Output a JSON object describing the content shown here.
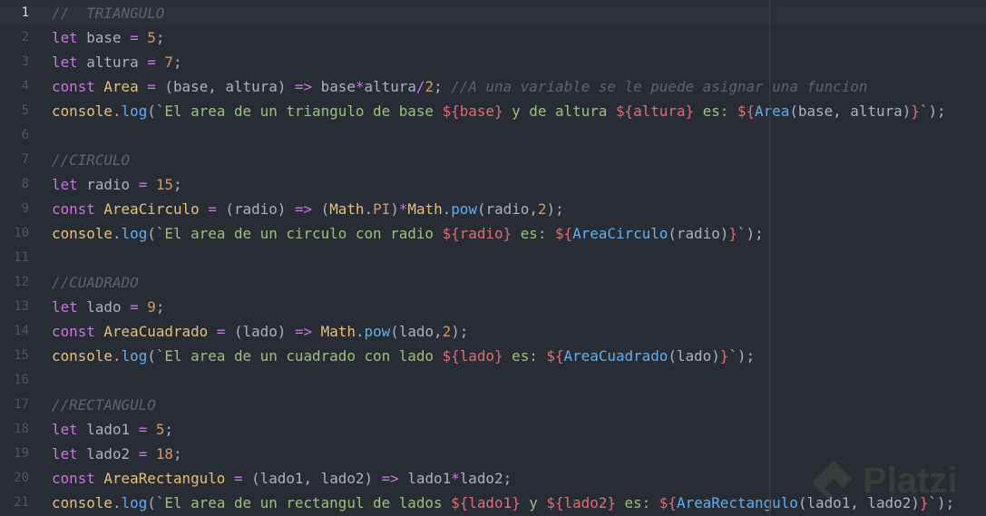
{
  "editor": {
    "active_line": 1,
    "lines": [
      {
        "n": "1",
        "tokens": [
          [
            "t-comment",
            "//  TRIANGULO"
          ]
        ]
      },
      {
        "n": "2",
        "tokens": [
          [
            "t-kw",
            "let"
          ],
          [
            "t-plain",
            " base "
          ],
          [
            "t-op",
            "="
          ],
          [
            "t-plain",
            " "
          ],
          [
            "t-num",
            "5"
          ],
          [
            "t-plain",
            ";"
          ]
        ]
      },
      {
        "n": "3",
        "tokens": [
          [
            "t-kw",
            "let"
          ],
          [
            "t-plain",
            " altura "
          ],
          [
            "t-op",
            "="
          ],
          [
            "t-plain",
            " "
          ],
          [
            "t-num",
            "7"
          ],
          [
            "t-plain",
            ";"
          ]
        ]
      },
      {
        "n": "4",
        "tokens": [
          [
            "t-kw",
            "const"
          ],
          [
            "t-plain",
            " "
          ],
          [
            "t-cls",
            "Area"
          ],
          [
            "t-plain",
            " "
          ],
          [
            "t-op",
            "="
          ],
          [
            "t-plain",
            " (base, altura) "
          ],
          [
            "t-op",
            "=>"
          ],
          [
            "t-plain",
            " base"
          ],
          [
            "t-op",
            "*"
          ],
          [
            "t-plain",
            "altura"
          ],
          [
            "t-op",
            "/"
          ],
          [
            "t-num",
            "2"
          ],
          [
            "t-plain",
            "; "
          ],
          [
            "t-comment",
            "//A una variable se le puede asignar una funcion"
          ]
        ]
      },
      {
        "n": "5",
        "tokens": [
          [
            "t-cls",
            "console"
          ],
          [
            "t-plain",
            "."
          ],
          [
            "t-fn",
            "log"
          ],
          [
            "t-plain",
            "("
          ],
          [
            "t-str",
            "`El area de un triangulo de base "
          ],
          [
            "t-tpl",
            "${"
          ],
          [
            "t-var",
            "base"
          ],
          [
            "t-tpl",
            "}"
          ],
          [
            "t-str",
            " y de altura "
          ],
          [
            "t-tpl",
            "${"
          ],
          [
            "t-var",
            "altura"
          ],
          [
            "t-tpl",
            "}"
          ],
          [
            "t-str",
            " es: "
          ],
          [
            "t-tpl",
            "${"
          ],
          [
            "t-fn",
            "Area"
          ],
          [
            "t-plain",
            "(base, altura)"
          ],
          [
            "t-tpl",
            "}"
          ],
          [
            "t-str",
            "`"
          ],
          [
            "t-plain",
            ");"
          ]
        ]
      },
      {
        "n": "6",
        "tokens": []
      },
      {
        "n": "7",
        "tokens": [
          [
            "t-comment",
            "//CIRCULO"
          ]
        ]
      },
      {
        "n": "8",
        "tokens": [
          [
            "t-kw",
            "let"
          ],
          [
            "t-plain",
            " radio "
          ],
          [
            "t-op",
            "="
          ],
          [
            "t-plain",
            " "
          ],
          [
            "t-num",
            "15"
          ],
          [
            "t-plain",
            ";"
          ]
        ]
      },
      {
        "n": "9",
        "tokens": [
          [
            "t-kw",
            "const"
          ],
          [
            "t-plain",
            " "
          ],
          [
            "t-cls",
            "AreaCirculo"
          ],
          [
            "t-plain",
            " "
          ],
          [
            "t-op",
            "="
          ],
          [
            "t-plain",
            " (radio) "
          ],
          [
            "t-op",
            "=>"
          ],
          [
            "t-plain",
            " ("
          ],
          [
            "t-cls",
            "Math"
          ],
          [
            "t-plain",
            "."
          ],
          [
            "t-prop",
            "PI"
          ],
          [
            "t-plain",
            ")"
          ],
          [
            "t-op",
            "*"
          ],
          [
            "t-cls",
            "Math"
          ],
          [
            "t-plain",
            "."
          ],
          [
            "t-fn",
            "pow"
          ],
          [
            "t-plain",
            "(radio,"
          ],
          [
            "t-num",
            "2"
          ],
          [
            "t-plain",
            ");"
          ]
        ]
      },
      {
        "n": "10",
        "tokens": [
          [
            "t-cls",
            "console"
          ],
          [
            "t-plain",
            "."
          ],
          [
            "t-fn",
            "log"
          ],
          [
            "t-plain",
            "("
          ],
          [
            "t-str",
            "`El area de un circulo con radio "
          ],
          [
            "t-tpl",
            "${"
          ],
          [
            "t-var",
            "radio"
          ],
          [
            "t-tpl",
            "}"
          ],
          [
            "t-str",
            " es: "
          ],
          [
            "t-tpl",
            "${"
          ],
          [
            "t-fn",
            "AreaCirculo"
          ],
          [
            "t-plain",
            "(radio)"
          ],
          [
            "t-tpl",
            "}"
          ],
          [
            "t-str",
            "`"
          ],
          [
            "t-plain",
            ");"
          ]
        ]
      },
      {
        "n": "11",
        "tokens": []
      },
      {
        "n": "12",
        "tokens": [
          [
            "t-comment",
            "//CUADRADO"
          ]
        ]
      },
      {
        "n": "13",
        "tokens": [
          [
            "t-kw",
            "let"
          ],
          [
            "t-plain",
            " lado "
          ],
          [
            "t-op",
            "="
          ],
          [
            "t-plain",
            " "
          ],
          [
            "t-num",
            "9"
          ],
          [
            "t-plain",
            ";"
          ]
        ]
      },
      {
        "n": "14",
        "tokens": [
          [
            "t-kw",
            "const"
          ],
          [
            "t-plain",
            " "
          ],
          [
            "t-cls",
            "AreaCuadrado"
          ],
          [
            "t-plain",
            " "
          ],
          [
            "t-op",
            "="
          ],
          [
            "t-plain",
            " (lado) "
          ],
          [
            "t-op",
            "=>"
          ],
          [
            "t-plain",
            " "
          ],
          [
            "t-cls",
            "Math"
          ],
          [
            "t-plain",
            "."
          ],
          [
            "t-fn",
            "pow"
          ],
          [
            "t-plain",
            "(lado,"
          ],
          [
            "t-num",
            "2"
          ],
          [
            "t-plain",
            ");"
          ]
        ]
      },
      {
        "n": "15",
        "tokens": [
          [
            "t-cls",
            "console"
          ],
          [
            "t-plain",
            "."
          ],
          [
            "t-fn",
            "log"
          ],
          [
            "t-plain",
            "("
          ],
          [
            "t-str",
            "`El area de un cuadrado con lado "
          ],
          [
            "t-tpl",
            "${"
          ],
          [
            "t-var",
            "lado"
          ],
          [
            "t-tpl",
            "}"
          ],
          [
            "t-str",
            " es: "
          ],
          [
            "t-tpl",
            "${"
          ],
          [
            "t-fn",
            "AreaCuadrado"
          ],
          [
            "t-plain",
            "(lado)"
          ],
          [
            "t-tpl",
            "}"
          ],
          [
            "t-str",
            "`"
          ],
          [
            "t-plain",
            ");"
          ]
        ]
      },
      {
        "n": "16",
        "tokens": []
      },
      {
        "n": "17",
        "tokens": [
          [
            "t-comment",
            "//RECTANGULO"
          ]
        ]
      },
      {
        "n": "18",
        "tokens": [
          [
            "t-kw",
            "let"
          ],
          [
            "t-plain",
            " lado1 "
          ],
          [
            "t-op",
            "="
          ],
          [
            "t-plain",
            " "
          ],
          [
            "t-num",
            "5"
          ],
          [
            "t-plain",
            ";"
          ]
        ]
      },
      {
        "n": "19",
        "tokens": [
          [
            "t-kw",
            "let"
          ],
          [
            "t-plain",
            " lado2 "
          ],
          [
            "t-op",
            "="
          ],
          [
            "t-plain",
            " "
          ],
          [
            "t-num",
            "18"
          ],
          [
            "t-plain",
            ";"
          ]
        ]
      },
      {
        "n": "20",
        "tokens": [
          [
            "t-kw",
            "const"
          ],
          [
            "t-plain",
            " "
          ],
          [
            "t-cls",
            "AreaRectangulo"
          ],
          [
            "t-plain",
            " "
          ],
          [
            "t-op",
            "="
          ],
          [
            "t-plain",
            " (lado1, lado2) "
          ],
          [
            "t-op",
            "=>"
          ],
          [
            "t-plain",
            " lado1"
          ],
          [
            "t-op",
            "*"
          ],
          [
            "t-plain",
            "lado2;"
          ]
        ]
      },
      {
        "n": "21",
        "tokens": [
          [
            "t-cls",
            "console"
          ],
          [
            "t-plain",
            "."
          ],
          [
            "t-fn",
            "log"
          ],
          [
            "t-plain",
            "("
          ],
          [
            "t-str",
            "`El area de un rectangul de lados "
          ],
          [
            "t-tpl",
            "${"
          ],
          [
            "t-var",
            "lado1"
          ],
          [
            "t-tpl",
            "}"
          ],
          [
            "t-str",
            " y "
          ],
          [
            "t-tpl",
            "${"
          ],
          [
            "t-var",
            "lado2"
          ],
          [
            "t-tpl",
            "}"
          ],
          [
            "t-str",
            " es: "
          ],
          [
            "t-tpl",
            "${"
          ],
          [
            "t-fn",
            "AreaRectangulo"
          ],
          [
            "t-plain",
            "(lado1, lado2)"
          ],
          [
            "t-tpl",
            "}"
          ],
          [
            "t-str",
            "`"
          ],
          [
            "t-plain",
            ");"
          ]
        ]
      }
    ]
  },
  "watermark": {
    "icon": "platzi-logo-icon",
    "text": "Platzi"
  },
  "colors": {
    "background": "#282c34",
    "keyword": "#c678dd",
    "number": "#d19a66",
    "string": "#98c379",
    "function": "#61afef",
    "class": "#e5c07b",
    "comment": "#5c6370",
    "template": "#e06c75"
  }
}
